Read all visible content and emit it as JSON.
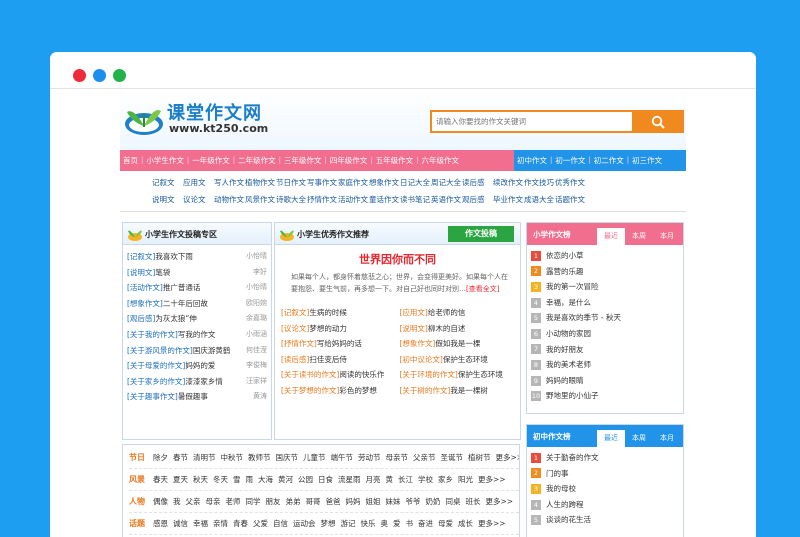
{
  "logo": {
    "title": "课堂作文网",
    "url": "www.kt250.com"
  },
  "search": {
    "placeholder": "请输入你要找的作文关键词"
  },
  "nav_pink": [
    "首页",
    "小学生作文",
    "一年级作文",
    "二年级作文",
    "三年级作文",
    "四年级作文",
    "五年级作文",
    "六年级作文"
  ],
  "nav_blue": [
    "初中作文",
    "初一作文",
    "初二作文",
    "初三作文"
  ],
  "links_row1": [
    "记叙文",
    "应用文",
    "写人作文",
    "植物作文",
    "节日作文",
    "写事作文",
    "家庭作文",
    "想象作文",
    "日记大全",
    "周记大全",
    "读后感",
    "续改作文",
    "作文技巧",
    "优秀作文"
  ],
  "links_row2": [
    "说明文",
    "议论文",
    "动物作文",
    "风景作文",
    "诗歌大全",
    "抒情作文",
    "活动作文",
    "童话作文",
    "读书笔记",
    "英语作文",
    "观后感",
    "毕业作文",
    "成语大全",
    "话题作文"
  ],
  "left_panel": {
    "title": "小学生作文投稿专区",
    "items": [
      {
        "tag": "[记叙文]",
        "title": "我喜欢下雨",
        "who": "小怡晴"
      },
      {
        "tag": "[说明文]",
        "title": "笔袋",
        "who": "李好"
      },
      {
        "tag": "[活动作文]",
        "title": "推广普通话",
        "who": "小怡晴"
      },
      {
        "tag": "[想象作文]",
        "title": "二十年后回故",
        "who": "欧阳婉"
      },
      {
        "tag": "[观后感]",
        "title": "为灰太狼“伸",
        "who": "余嘉璐"
      },
      {
        "tag": "[关于我的作文]",
        "title": "写我的作文",
        "who": "小雨涵"
      },
      {
        "tag": "[关于游风景的作文]",
        "title": "国庆游黄鹤",
        "who": "何佳滢"
      },
      {
        "tag": "[关于母爱的作文]",
        "title": "妈妈的爱",
        "who": "李俊梅"
      },
      {
        "tag": "[关于家乡的作文]",
        "title": "漆漆家乡情",
        "who": "汪家祥"
      },
      {
        "tag": "[关于趣事作文]",
        "title": "暑假趣事",
        "who": "黄涛"
      }
    ]
  },
  "mid_panel": {
    "title": "小学生优秀作文推荐",
    "submit": "作文投稿",
    "headline": "世界因你而不同",
    "desc": "如果每个人，都身怀着慈悲之心；世界，会变得更美好。如果每个人在要抱怨、要生气前，再多想一下。对自己好也同时对别…",
    "more": "[查看全文]",
    "items": [
      {
        "tag": "[记叙文]",
        "title": "生病的时候"
      },
      {
        "tag": "[应用文]",
        "title": "给老师的信"
      },
      {
        "tag": "[议论文]",
        "title": "梦想的动力"
      },
      {
        "tag": "[说明文]",
        "title": "柳木的自述"
      },
      {
        "tag": "[抒情作文]",
        "title": "写给妈妈的话"
      },
      {
        "tag": "[想象作文]",
        "title": "假如我是一棵"
      },
      {
        "tag": "[读后感]",
        "title": "扫佳变后侍"
      },
      {
        "tag": "[初中议论文]",
        "title": "保护生态环境"
      },
      {
        "tag": "[关于读书的作文]",
        "title": "阅读的快乐作"
      },
      {
        "tag": "[关于环境的作文]",
        "title": "保护生态环境"
      },
      {
        "tag": "[关于梦想的作文]",
        "title": "彩色的梦想"
      },
      {
        "tag": "[关于树的作文]",
        "title": "我是一棵树"
      }
    ]
  },
  "right_top": {
    "title": "小学作文榜",
    "tabs": [
      "最近",
      "本周",
      "本月"
    ],
    "items": [
      "依恋的小草",
      "露营的乐趣",
      "我的第一次冒险",
      "幸福，是什么",
      "我是喜欢的季节 - 秋天",
      "小动物的家园",
      "我的好朋友",
      "我的美术老师",
      "妈妈的眼睛",
      "野地里的小仙子"
    ]
  },
  "right_bottom": {
    "title": "初中作文榜",
    "tabs": [
      "最近",
      "本周",
      "本月"
    ],
    "items": [
      "关于勤奋的作文",
      "门的事",
      "我的母校",
      "人生的跨程",
      "谈谈的花生活"
    ]
  },
  "bottom_tags": [
    {
      "label": "节日",
      "items": [
        "除夕",
        "春节",
        "清明节",
        "中秋节",
        "教师节",
        "国庆节",
        "儿童节",
        "端午节",
        "劳动节",
        "母亲节",
        "父亲节",
        "圣诞节",
        "植树节",
        "更多>>"
      ]
    },
    {
      "label": "风景",
      "items": [
        "春天",
        "夏天",
        "秋天",
        "冬天",
        "雪",
        "雨",
        "大海",
        "黄河",
        "公园",
        "日食",
        "流星雨",
        "月亮",
        "黄",
        "长江",
        "学校",
        "家乡",
        "阳光",
        "更多>>"
      ]
    },
    {
      "label": "人物",
      "items": [
        "偶像",
        "我",
        "父亲",
        "母亲",
        "老师",
        "同学",
        "朋友",
        "弟弟",
        "哥哥",
        "爸爸",
        "妈妈",
        "姐姐",
        "妹妹",
        "爷爷",
        "奶奶",
        "同桌",
        "班长",
        "更多>>"
      ]
    },
    {
      "label": "话题",
      "items": [
        "感恩",
        "诚信",
        "幸福",
        "亲情",
        "青春",
        "父爱",
        "自信",
        "运动会",
        "梦想",
        "游记",
        "快乐",
        "奥",
        "爱",
        "书",
        "奋进",
        "母爱",
        "成长",
        "更多>>"
      ]
    }
  ],
  "colors": {
    "pink": "#f26e8e",
    "blue": "#2193e8",
    "orange": "#f08a1e",
    "green": "#2aa541",
    "red": "#e6262e"
  }
}
